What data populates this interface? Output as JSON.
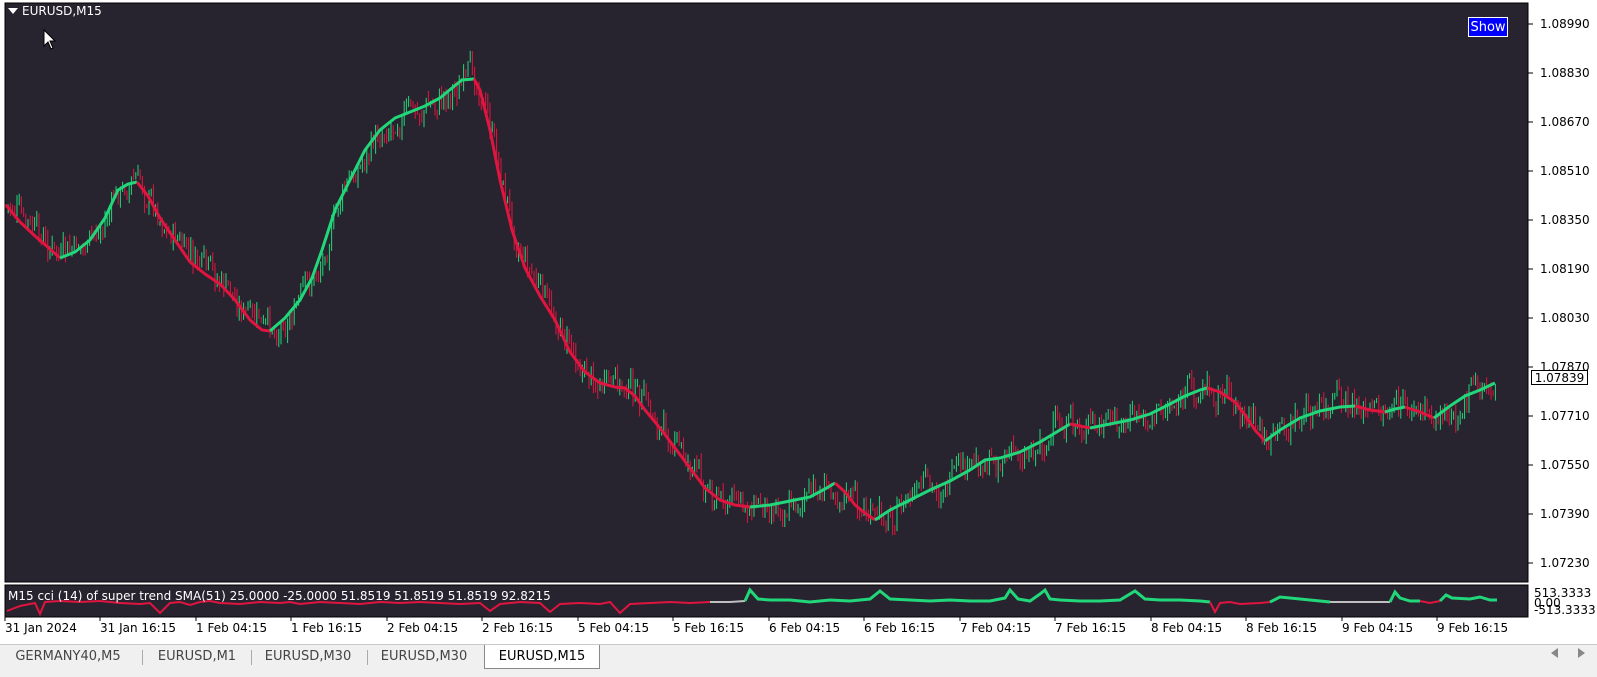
{
  "chart": {
    "symbol": "EURUSD,M15",
    "show_button": "Show",
    "current_price": "1.07839",
    "price_labels": [
      "1.08990",
      "1.08830",
      "1.08670",
      "1.08510",
      "1.08350",
      "1.08190",
      "1.08030",
      "1.07870",
      "1.07710",
      "1.07550",
      "1.07390",
      "1.07230"
    ],
    "time_labels": [
      "31 Jan 2024",
      "31 Jan 16:15",
      "1 Feb 04:15",
      "1 Feb 16:15",
      "2 Feb 04:15",
      "2 Feb 16:15",
      "5 Feb 04:15",
      "5 Feb 16:15",
      "6 Feb 04:15",
      "6 Feb 16:15",
      "7 Feb 04:15",
      "7 Feb 16:15",
      "8 Feb 04:15",
      "8 Feb 16:15",
      "9 Feb 04:15",
      "9 Feb 16:15"
    ],
    "colors": {
      "background": "#27232f",
      "bull": "#22d67a",
      "bear": "#e0153f",
      "neutral": "#bfbfbf"
    }
  },
  "indicator": {
    "title": "M15 cci (14) of super trend SMA(51) 25.0000 -25.0000 51.8519 51.8519 51.8519 92.8215",
    "upper_label": "513.3333",
    "zero_label": "0.00",
    "lower_label": "-513.3333"
  },
  "tabs": [
    {
      "label": "GERMANY40,M5",
      "active": false
    },
    {
      "label": "EURUSD,M1",
      "active": false
    },
    {
      "label": "EURUSD,M30",
      "active": false
    },
    {
      "label": "EURUSD,M30",
      "active": false
    },
    {
      "label": "EURUSD,M15",
      "active": true
    }
  ]
}
